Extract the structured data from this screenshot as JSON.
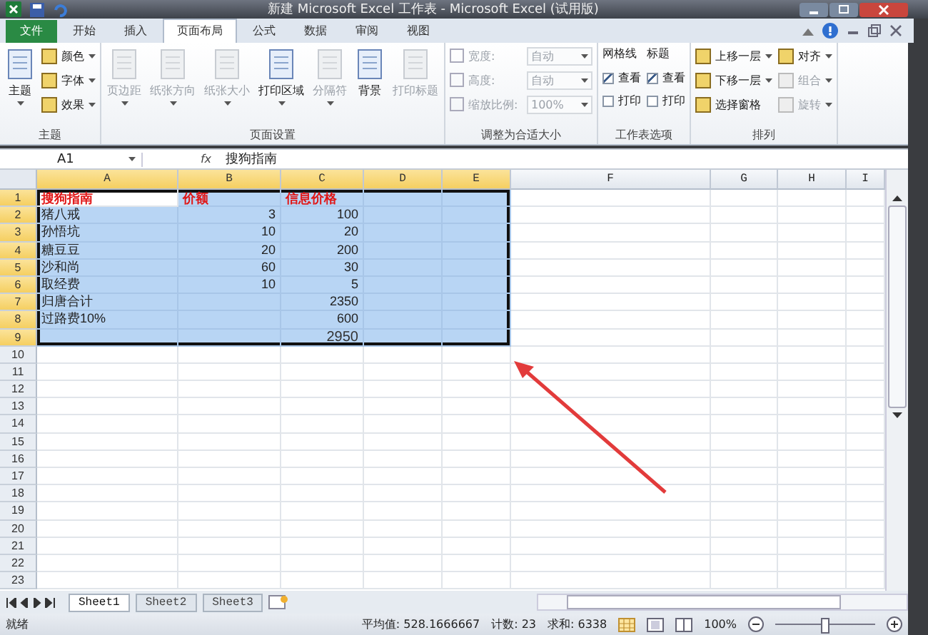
{
  "window": {
    "title": "新建 Microsoft Excel 工作表 - Microsoft Excel (试用版)"
  },
  "tabs": [
    {
      "label": "文件",
      "kind": "file",
      "selected": false
    },
    {
      "label": "开始",
      "kind": "tab",
      "selected": false
    },
    {
      "label": "插入",
      "kind": "tab",
      "selected": false
    },
    {
      "label": "页面布局",
      "kind": "tab",
      "selected": true
    },
    {
      "label": "公式",
      "kind": "tab",
      "selected": false
    },
    {
      "label": "数据",
      "kind": "tab",
      "selected": false
    },
    {
      "label": "审阅",
      "kind": "tab",
      "selected": false
    },
    {
      "label": "视图",
      "kind": "tab",
      "selected": false
    }
  ],
  "ribbon": {
    "groups": [
      {
        "label": "主题",
        "columns": [
          [
            {
              "kind": "large",
              "label": "主题",
              "dropdown": true,
              "disabled": false
            }
          ],
          [
            {
              "kind": "small",
              "label": "颜色",
              "dropdown": true,
              "disabled": false
            },
            {
              "kind": "small",
              "label": "字体",
              "dropdown": true,
              "disabled": false
            },
            {
              "kind": "small",
              "label": "效果",
              "dropdown": true,
              "disabled": false
            }
          ]
        ]
      },
      {
        "label": "页面设置",
        "columns": [
          [
            {
              "kind": "large",
              "label": "页边距",
              "dropdown": true,
              "disabled": true
            }
          ],
          [
            {
              "kind": "large",
              "label": "纸张方向",
              "dropdown": true,
              "disabled": true
            }
          ],
          [
            {
              "kind": "large",
              "label": "纸张大小",
              "dropdown": true,
              "disabled": true
            }
          ],
          [
            {
              "kind": "large",
              "label": "打印区域",
              "dropdown": true,
              "disabled": false
            }
          ],
          [
            {
              "kind": "large",
              "label": "分隔符",
              "dropdown": true,
              "disabled": true
            }
          ],
          [
            {
              "kind": "large",
              "label": "背景",
              "dropdown": false,
              "disabled": false
            }
          ],
          [
            {
              "kind": "large",
              "label": "打印标题",
              "dropdown": false,
              "disabled": true
            }
          ]
        ]
      },
      {
        "label": "调整为合适大小",
        "columns": [
          [
            {
              "kind": "field",
              "label": "宽度:",
              "value": "自动",
              "disabled": true
            },
            {
              "kind": "field",
              "label": "高度:",
              "value": "自动",
              "disabled": true
            },
            {
              "kind": "field",
              "label": "缩放比例:",
              "value": "100%",
              "disabled": true
            }
          ]
        ]
      },
      {
        "label": "工作表选项",
        "columns": [
          [
            {
              "kind": "heading",
              "label": "网格线"
            },
            {
              "kind": "check",
              "label": "查看",
              "checked": true
            },
            {
              "kind": "check",
              "label": "打印",
              "checked": false
            }
          ],
          [
            {
              "kind": "heading",
              "label": "标题"
            },
            {
              "kind": "check",
              "label": "查看",
              "checked": true
            },
            {
              "kind": "check",
              "label": "打印",
              "checked": false
            }
          ]
        ]
      },
      {
        "label": "排列",
        "columns": [
          [
            {
              "kind": "small",
              "label": "上移一层",
              "dropdown": true,
              "disabled": false
            },
            {
              "kind": "small",
              "label": "下移一层",
              "dropdown": true,
              "disabled": false
            },
            {
              "kind": "small",
              "label": "选择窗格",
              "dropdown": false,
              "disabled": false
            }
          ],
          [
            {
              "kind": "small",
              "label": "对齐",
              "dropdown": true,
              "disabled": false
            },
            {
              "kind": "small",
              "label": "组合",
              "dropdown": true,
              "disabled": true
            },
            {
              "kind": "small",
              "label": "旋转",
              "dropdown": true,
              "disabled": true
            }
          ]
        ]
      }
    ]
  },
  "formula_bar": {
    "name_box": "A1",
    "fx": "fx",
    "value": "搜狗指南"
  },
  "sheet": {
    "columns": [
      {
        "label": "A",
        "selected": true
      },
      {
        "label": "B",
        "selected": true
      },
      {
        "label": "C",
        "selected": true
      },
      {
        "label": "D",
        "selected": true
      },
      {
        "label": "E",
        "selected": true
      },
      {
        "label": "F",
        "selected": false
      },
      {
        "label": "G",
        "selected": false
      },
      {
        "label": "H",
        "selected": false
      },
      {
        "label": "I",
        "selected": false
      }
    ],
    "rows": [
      {
        "header": "1",
        "selected": true,
        "kind": "heading",
        "cells": [
          "搜狗指南",
          "价额",
          "信息价格"
        ]
      },
      {
        "header": "2",
        "selected": true,
        "kind": "data",
        "cells": [
          "猪八戒",
          "3",
          "100"
        ]
      },
      {
        "header": "3",
        "selected": true,
        "kind": "data",
        "cells": [
          "孙悟坑",
          "10",
          "20"
        ]
      },
      {
        "header": "4",
        "selected": true,
        "kind": "data",
        "cells": [
          "糖豆豆",
          "20",
          "200"
        ]
      },
      {
        "header": "5",
        "selected": true,
        "kind": "data",
        "cells": [
          "沙和尚",
          "60",
          "30"
        ]
      },
      {
        "header": "6",
        "selected": true,
        "kind": "data",
        "cells": [
          "取经费",
          "10",
          "5"
        ]
      },
      {
        "header": "7",
        "selected": true,
        "kind": "data",
        "cells": [
          "归唐合计",
          "",
          "2350"
        ]
      },
      {
        "header": "8",
        "selected": true,
        "kind": "data",
        "cells": [
          "过路费10%",
          "",
          "600"
        ]
      },
      {
        "header": "9",
        "selected": true,
        "kind": "total",
        "cells": [
          "",
          "",
          "2950"
        ]
      },
      {
        "header": "10",
        "selected": false,
        "kind": "data",
        "cells": []
      },
      {
        "header": "11",
        "selected": false,
        "kind": "data",
        "cells": []
      },
      {
        "header": "12",
        "selected": false,
        "kind": "data",
        "cells": []
      },
      {
        "header": "13",
        "selected": false,
        "kind": "data",
        "cells": []
      },
      {
        "header": "14",
        "selected": false,
        "kind": "data",
        "cells": []
      },
      {
        "header": "15",
        "selected": false,
        "kind": "data",
        "cells": []
      },
      {
        "header": "16",
        "selected": false,
        "kind": "data",
        "cells": []
      },
      {
        "header": "17",
        "selected": false,
        "kind": "data",
        "cells": []
      },
      {
        "header": "18",
        "selected": false,
        "kind": "data",
        "cells": []
      },
      {
        "header": "19",
        "selected": false,
        "kind": "data",
        "cells": []
      },
      {
        "header": "20",
        "selected": false,
        "kind": "data",
        "cells": []
      },
      {
        "header": "21",
        "selected": false,
        "kind": "data",
        "cells": []
      },
      {
        "header": "22",
        "selected": false,
        "kind": "data",
        "cells": []
      },
      {
        "header": "23",
        "selected": false,
        "kind": "data",
        "cells": []
      }
    ]
  },
  "sheet_tabs": [
    {
      "label": "Sheet1",
      "selected": true
    },
    {
      "label": "Sheet2",
      "selected": false
    },
    {
      "label": "Sheet3",
      "selected": false
    }
  ],
  "status_bar": {
    "state": "就绪",
    "average": "平均值: 528.1666667",
    "count": "计数: 23",
    "sum": "求和: 6338",
    "zoom": "100%",
    "zoom_level": {
      "level": 0.5
    }
  }
}
